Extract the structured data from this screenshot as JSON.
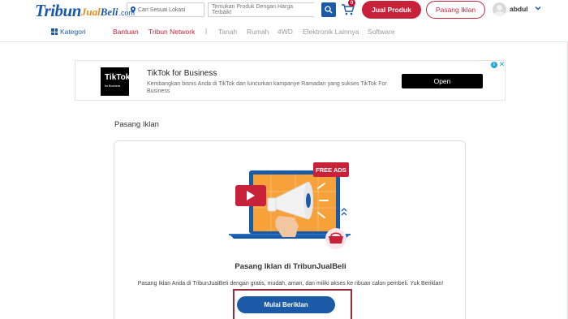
{
  "header": {
    "logo": {
      "tribun": "Tribun",
      "jual": "Jual",
      "beli": "Beli",
      "domain": ".com"
    },
    "location_placeholder": "Cari Sesuai Lokasi",
    "search_placeholder": "Temukan Produk Dengan Harga Terbaik!",
    "cart_count": "0",
    "jual_produk": "Jual Produk",
    "pasang_iklan": "Pasang Iklan",
    "username": "abdul"
  },
  "nav": {
    "kategori": "Kategori",
    "primary_links": [
      "Bantuan",
      "Tribun Network"
    ],
    "separator": "|",
    "secondary_links": [
      "Tanah",
      "Rumah",
      "4WD",
      "Elektronik Lainnya",
      "Software"
    ]
  },
  "ad": {
    "logo_title": "TikTok",
    "logo_subtitle": "for Business",
    "title": "TikTok for Business",
    "description": "Kembangkan bisnis Anda di TikTok dan luncurkan kampanye Ramadan yang sukses TikTok For Business",
    "cta": "Open"
  },
  "main": {
    "section_title": "Pasang Iklan",
    "illustration_badge": "FREE ADS",
    "card_title": "Pasang Iklan di TribunJualBeli",
    "card_description": "Pasang Iklan Anda di TribunJualBeli dengan gratis, mudah, aman, dan miliki akses ke ribuan calon pembeli. Yuk Beriklan!",
    "cta": "Mulai Beriklan"
  },
  "colors": {
    "brand_blue": "#1b5aa6",
    "brand_red": "#c8223a",
    "highlight_border": "#9a2b3c"
  }
}
